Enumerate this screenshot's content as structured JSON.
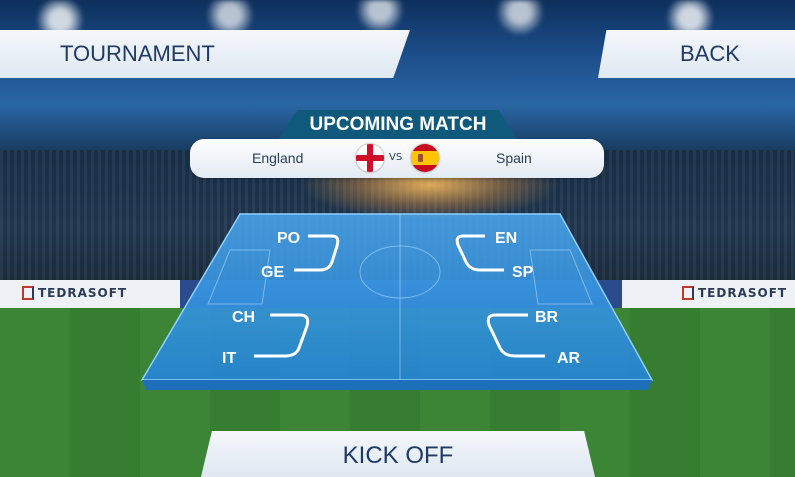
{
  "header": {
    "tournament_label": "TOURNAMENT",
    "back_label": "BACK"
  },
  "upcoming_match": {
    "title": "UPCOMING MATCH",
    "team_a": "England",
    "vs": "VS",
    "team_b": "Spain",
    "flag_a_icon": "england-flag-icon",
    "flag_b_icon": "spain-flag-icon"
  },
  "bracket": {
    "left_group_top": [
      "PO",
      "GE"
    ],
    "left_group_bottom": [
      "CH",
      "IT"
    ],
    "right_group_top": [
      "EN",
      "SP"
    ],
    "right_group_bottom": [
      "BR",
      "AR"
    ]
  },
  "sponsor": {
    "name": "TEDRASOFT"
  },
  "footer": {
    "kickoff_label": "KICK OFF"
  },
  "colors": {
    "panel_blue": "#2f8fe0",
    "header_teal": "#0f5a7c",
    "button_text": "#1f3a64"
  }
}
